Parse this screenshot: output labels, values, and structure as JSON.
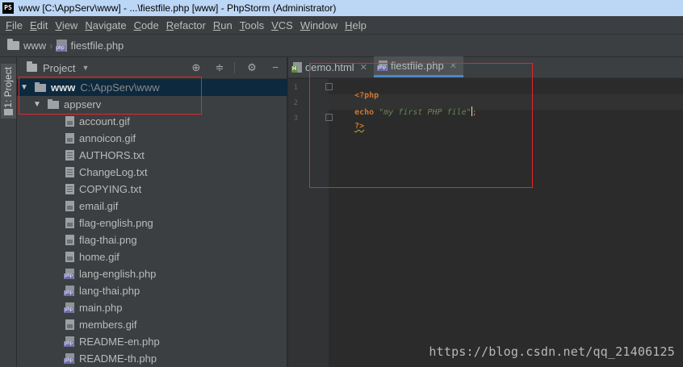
{
  "window": {
    "icon_text": "PS",
    "title": "www [C:\\AppServ\\www] - ...\\fiestfile.php [www] - PhpStorm (Administrator)"
  },
  "menu": [
    {
      "mnemonic": "F",
      "rest": "ile"
    },
    {
      "mnemonic": "E",
      "rest": "dit"
    },
    {
      "mnemonic": "V",
      "rest": "iew"
    },
    {
      "mnemonic": "N",
      "rest": "avigate"
    },
    {
      "mnemonic": "C",
      "rest": "ode"
    },
    {
      "mnemonic": "R",
      "rest": "efactor"
    },
    {
      "mnemonic": "R",
      "rest": "un",
      "pre": ""
    },
    {
      "mnemonic": "T",
      "rest": "ools"
    },
    {
      "mnemonic": "V",
      "rest": "CS"
    },
    {
      "mnemonic": "W",
      "rest": "indow"
    },
    {
      "mnemonic": "H",
      "rest": "elp"
    }
  ],
  "breadcrumb": {
    "root": "www",
    "file": "fiestfile.php"
  },
  "stripe": {
    "project_tab": "1: Project"
  },
  "project_panel": {
    "title": "Project",
    "root": {
      "name": "www",
      "path": "C:\\AppServ\\www"
    },
    "folder": "appserv",
    "files": [
      {
        "name": "account.gif",
        "kind": "img"
      },
      {
        "name": "annoicon.gif",
        "kind": "img"
      },
      {
        "name": "AUTHORS.txt",
        "kind": "txt"
      },
      {
        "name": "ChangeLog.txt",
        "kind": "txt"
      },
      {
        "name": "COPYING.txt",
        "kind": "txt"
      },
      {
        "name": "email.gif",
        "kind": "img"
      },
      {
        "name": "flag-english.png",
        "kind": "img"
      },
      {
        "name": "flag-thai.png",
        "kind": "img"
      },
      {
        "name": "home.gif",
        "kind": "img"
      },
      {
        "name": "lang-english.php",
        "kind": "php"
      },
      {
        "name": "lang-thai.php",
        "kind": "php"
      },
      {
        "name": "main.php",
        "kind": "php"
      },
      {
        "name": "members.gif",
        "kind": "img"
      },
      {
        "name": "README-en.php",
        "kind": "php"
      },
      {
        "name": "README-th.php",
        "kind": "php"
      }
    ]
  },
  "editor": {
    "tabs": [
      {
        "label": "demo.html",
        "icon": "html-file-icon",
        "active": false
      },
      {
        "label": "fiestfile.php",
        "icon": "php-file-icon",
        "active": true
      }
    ],
    "lines": [
      {
        "no": "1",
        "open_tag": "<?php"
      },
      {
        "no": "2",
        "keyword": "echo",
        "string": "\"my first PHP file\"",
        "semicolon": ";"
      },
      {
        "no": "3",
        "close_tag": "?>"
      }
    ]
  },
  "watermark": "https://blog.csdn.net/qq_21406125",
  "colors": {
    "annotation": "#e0282a",
    "selection": "#0d293e",
    "keyword": "#cc7832",
    "string": "#6a8759",
    "active_tab_underline": "#4a88c7"
  }
}
